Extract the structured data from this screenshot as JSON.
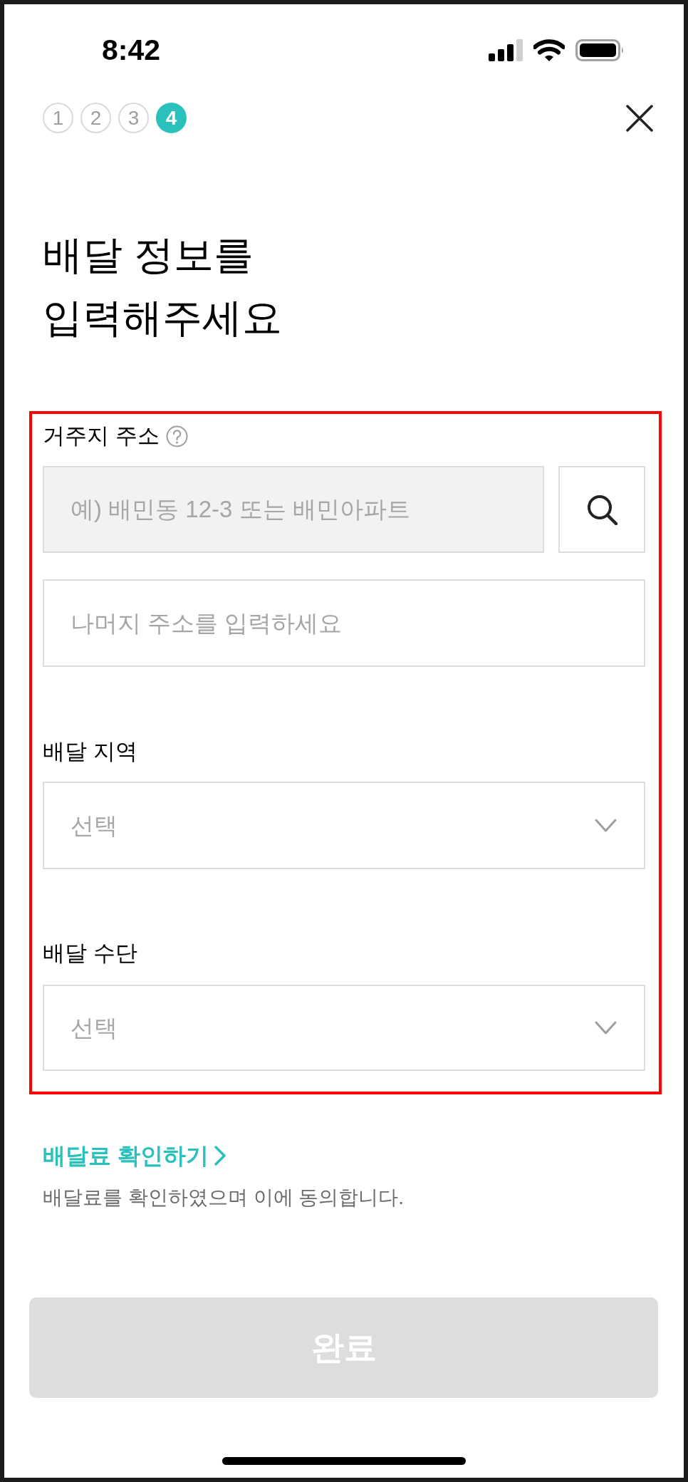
{
  "status_bar": {
    "time": "8:42"
  },
  "steps": [
    {
      "label": "1",
      "selected": false
    },
    {
      "label": "2",
      "selected": false
    },
    {
      "label": "3",
      "selected": false
    },
    {
      "label": "4",
      "selected": true
    }
  ],
  "title": "배달 정보를\n입력해주세요",
  "form": {
    "address": {
      "label": "거주지 주소",
      "search_field": {
        "placeholder": "예) 배민동 12-3 또는 배민아파트"
      },
      "detail_field": {
        "placeholder": "나머지 주소를 입력하세요"
      }
    },
    "selects": [
      {
        "label": "배달 지역",
        "placeholder": "선택"
      },
      {
        "label": "배달 수단",
        "placeholder": "선택"
      }
    ]
  },
  "fee_link": {
    "label": "배달료 확인하기"
  },
  "agreement": "배달료를 확인하였으며 이에 동의합니다.",
  "submit_button": {
    "label": "완료",
    "disabled": true
  }
}
